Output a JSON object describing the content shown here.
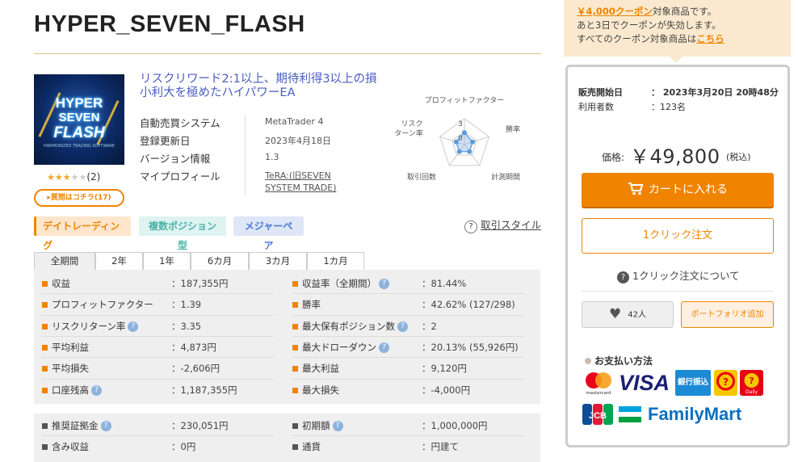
{
  "title": "HYPER_SEVEN_FLASH",
  "thumb": {
    "line1": "HYPER",
    "line2": "SEVEN",
    "line3": "FLASH",
    "tagline": "HARMONIZED TRADING SOFTWARE"
  },
  "rating": {
    "filled": "★★★",
    "empty": "★★",
    "count": "(2)",
    "value": 3,
    "max": 5
  },
  "question_button": "▸質問はコチラ(17)",
  "description": "リスクリワード2:1以上、期待利得3以上の損小利大を極めたハイパワーEA",
  "info": [
    {
      "key": "自動売買システム",
      "value": "MetaTrader 4"
    },
    {
      "key": "登録更新日",
      "value": "2023年4月18日"
    },
    {
      "key": "バージョン情報",
      "value": "1.3"
    },
    {
      "key": "マイプロフィール",
      "value": "TeRA:(旧SEVEN SYSTEM TRADE)"
    }
  ],
  "radar": {
    "labels": [
      "プロフィットファクター",
      "勝率",
      "計測期間",
      "取引回数",
      "リスク\nターン率"
    ],
    "label_top": "プロフィットファクター",
    "label_right": "勝率",
    "label_br": "計測期間",
    "label_bl": "取引回数",
    "label_left_1": "リスク",
    "label_left_2": "ターン率",
    "scale_outer": "3",
    "scale_inner": "0",
    "values": [
      1.39,
      1.0,
      1.0,
      1.0,
      1.0
    ],
    "max": 3
  },
  "tags": [
    "デイトレーディング",
    "複数ポジション型",
    "メジャーペア"
  ],
  "trade_style": {
    "icon": "?",
    "label": "取引スタイル"
  },
  "tabs": [
    "全期間",
    "2年",
    "1年",
    "6カ月",
    "3カ月",
    "1カ月"
  ],
  "stats_left": [
    {
      "label": "収益",
      "value": "：187,355円",
      "hint": false
    },
    {
      "label": "プロフィットファクター",
      "value": "：1.39",
      "hint": false
    },
    {
      "label": "リスクリターン率",
      "value": "：3.35",
      "hint": true
    },
    {
      "label": "平均利益",
      "value": "：4,873円",
      "hint": false
    },
    {
      "label": "平均損失",
      "value": "：-2,606円",
      "hint": false
    },
    {
      "label": "口座残高",
      "value": "：1,187,355円",
      "hint": true
    }
  ],
  "stats_right": [
    {
      "label": "収益率（全期間）",
      "value": "：81.44%",
      "hint": true
    },
    {
      "label": "勝率",
      "value": "：42.62% (127/298)",
      "hint": false
    },
    {
      "label": "最大保有ポジション数",
      "value": "：2",
      "hint": true
    },
    {
      "label": "最大ドローダウン",
      "value": "：20.13% (55,926円)",
      "hint": true
    },
    {
      "label": "最大利益",
      "value": "：9,120円",
      "hint": false
    },
    {
      "label": "最大損失",
      "value": "：-4,000円",
      "hint": false
    }
  ],
  "stats2_left": [
    {
      "label": "推奨証拠金",
      "value": "：230,051円",
      "hint": true
    },
    {
      "label": "含み収益",
      "value": "：0円",
      "hint": false
    }
  ],
  "stats2_right": [
    {
      "label": "初期額",
      "value": "：1,000,000円",
      "hint": true
    },
    {
      "label": "通貨",
      "value": "：円建て",
      "hint": false
    }
  ],
  "coupon": {
    "amount": "￥4,000クーポン",
    "line1_rest": "対象商品です。",
    "line2": "あと3日でクーポンが失効します。",
    "line3": "すべてのクーポン対象商品は",
    "link": "こちら"
  },
  "sale": {
    "start_label": "販売開始日",
    "start_value": "：  2023年3月20日 20時48分",
    "users_label": "利用者数",
    "users_value": "：123名"
  },
  "price": {
    "label": "価格:",
    "value": "￥49,800",
    "tax": "(税込)"
  },
  "cart_button": "カートに入れる",
  "oneclick_button": "1クリック注文",
  "about_oneclick": "1クリック注文について",
  "like": {
    "count": "42人"
  },
  "portfolio_button": "ポートフォリオ追加",
  "payment": {
    "title": "お支払い方法",
    "mastercard": "mastercard",
    "visa": "VISA",
    "bank": "銀行振込",
    "jcb": "JCB",
    "familymart": "FamilyMart",
    "daily": "Daily"
  },
  "colors": {
    "accent": "#f08300",
    "link": "#4a5dbf",
    "panel": "#efefef"
  }
}
